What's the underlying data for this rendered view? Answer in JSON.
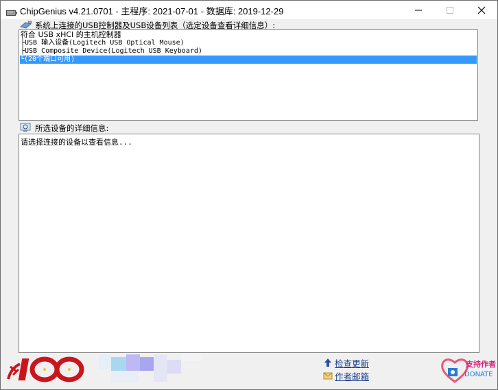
{
  "window": {
    "title": "ChipGenius v4.21.0701 - 主程序: 2021-07-01 - 数据库: 2019-12-29"
  },
  "device_section": {
    "label": "系统上连接的USB控制器及USB设备列表（选定设备查看详细信息）:"
  },
  "device_tree": {
    "root": "符合 USB xHCI 的主机控制器",
    "children": [
      "├USB 输入设备(Logitech USB Optical Mouse)",
      "├USB Composite Device(Logitech USB Keyboard)",
      "└(20个端口可用)"
    ]
  },
  "detail_section": {
    "label": "所选设备的详细信息:",
    "text": "请选择连接的设备以查看信息..."
  },
  "footer": {
    "check_update": "检查更新",
    "author_mail": "作者邮箱",
    "donate_cn": "支持作者",
    "donate_en": "DONATE"
  },
  "colors": {
    "selection": "#3399ff",
    "link": "#1d3f8f",
    "logo_red": "#c9161c"
  }
}
